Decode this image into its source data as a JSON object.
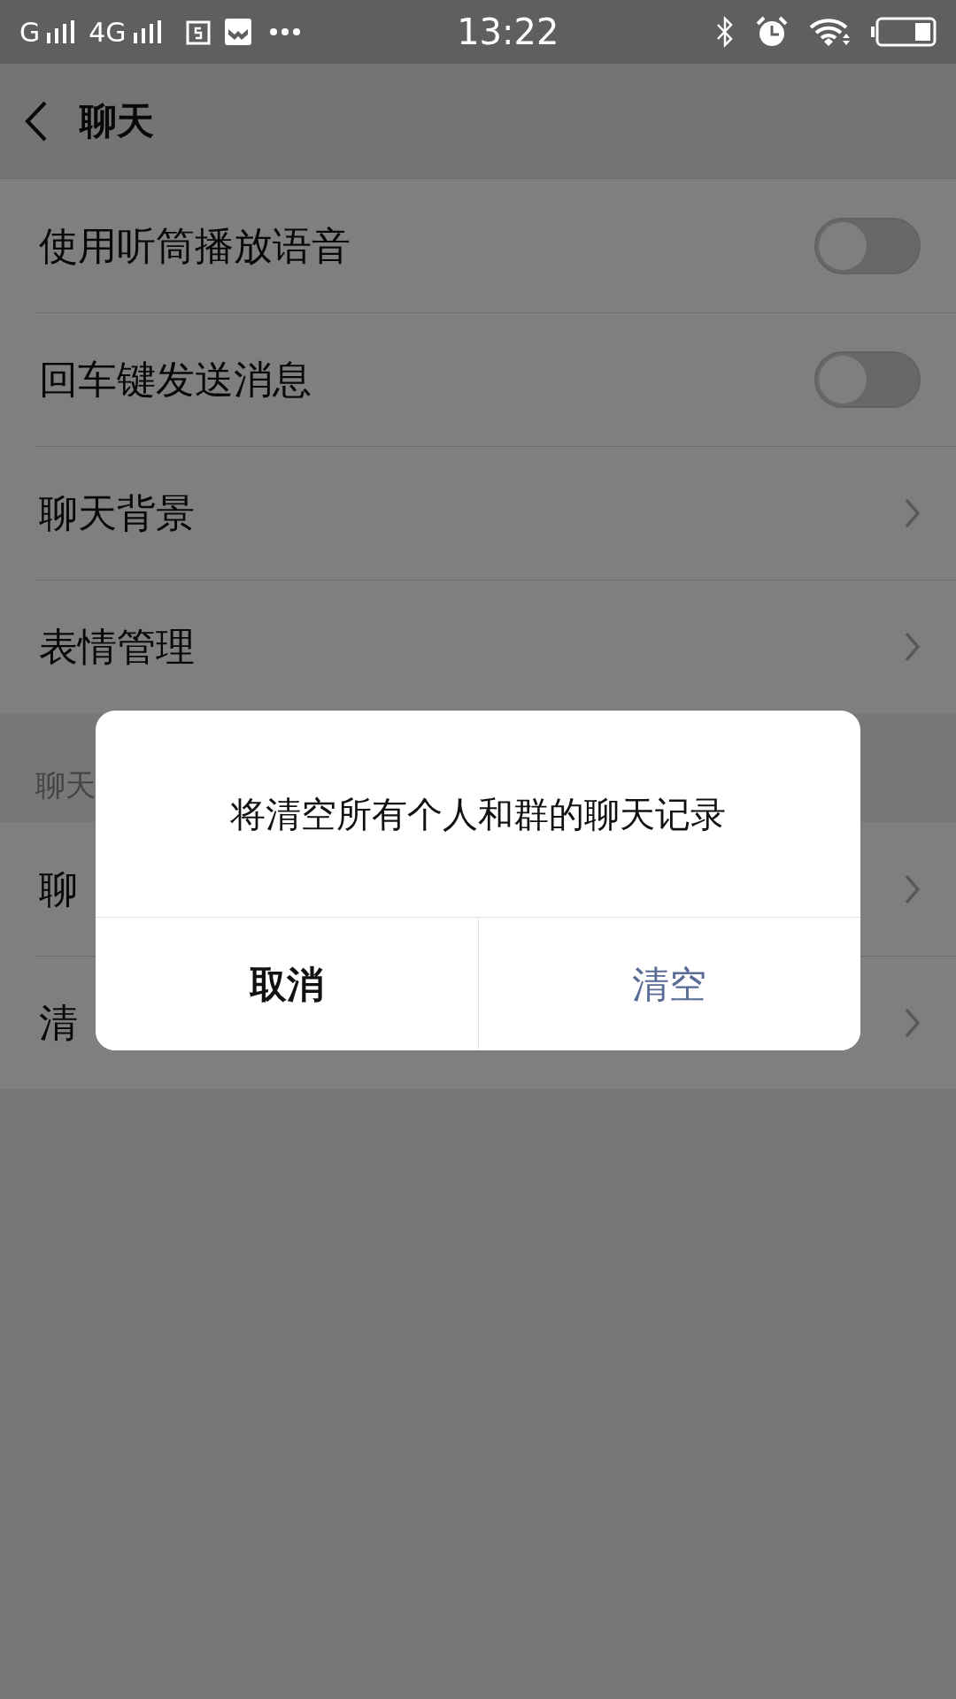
{
  "status_bar": {
    "network_1": "G",
    "network_2": "4G",
    "time": "13:22"
  },
  "header": {
    "title": "聊天"
  },
  "groups": [
    {
      "items": [
        {
          "kind": "toggle",
          "label": "使用听筒播放语音",
          "on": false
        },
        {
          "kind": "toggle",
          "label": "回车键发送消息",
          "on": false
        },
        {
          "kind": "link",
          "label": "聊天背景"
        },
        {
          "kind": "link",
          "label": "表情管理"
        }
      ]
    },
    {
      "label": "聊天",
      "items": [
        {
          "kind": "link",
          "label": "聊"
        },
        {
          "kind": "link",
          "label": "清"
        }
      ]
    }
  ],
  "dialog": {
    "message": "将清空所有个人和群的聊天记录",
    "buttons": [
      {
        "label": "取消",
        "kind": "cancel"
      },
      {
        "label": "清空",
        "kind": "confirm"
      }
    ]
  }
}
